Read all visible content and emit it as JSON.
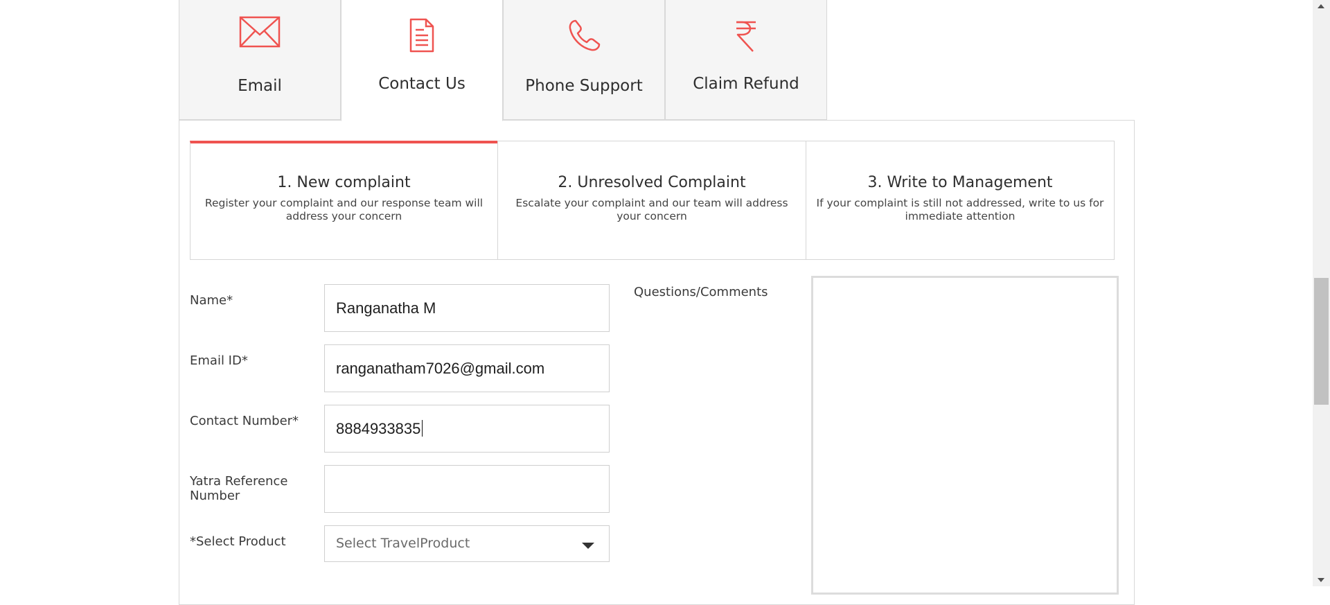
{
  "tabs": [
    {
      "label": "Email",
      "icon": "envelope-icon"
    },
    {
      "label": "Contact Us",
      "icon": "document-icon"
    },
    {
      "label": "Phone Support",
      "icon": "phone-icon"
    },
    {
      "label": "Claim Refund",
      "icon": "rupee-icon"
    }
  ],
  "active_tab": "Contact Us",
  "steps": [
    {
      "title": "1. New complaint",
      "desc": "Register your complaint and our response team will address your concern"
    },
    {
      "title": "2. Unresolved Complaint",
      "desc": "Escalate your complaint and our team will address your concern"
    },
    {
      "title": "3. Write to Management",
      "desc": "If your complaint is still not addressed, write to us for immediate attention"
    }
  ],
  "form": {
    "name": {
      "label": "Name*",
      "value": "Ranganatha M"
    },
    "email": {
      "label": "Email ID*",
      "value": "ranganatham7026@gmail.com"
    },
    "contact": {
      "label": "Contact Number*",
      "value": "8884933835"
    },
    "reference": {
      "label": "Yatra Reference Number",
      "value": ""
    },
    "product": {
      "label": "*Select Product",
      "value": "Select TravelProduct"
    },
    "comments": {
      "label": "Questions/Comments",
      "value": ""
    }
  },
  "colors": {
    "accent": "#ef5350",
    "icon": "#ef5350",
    "tab_bg": "#f5f5f5",
    "border": "#d8d8d8"
  }
}
